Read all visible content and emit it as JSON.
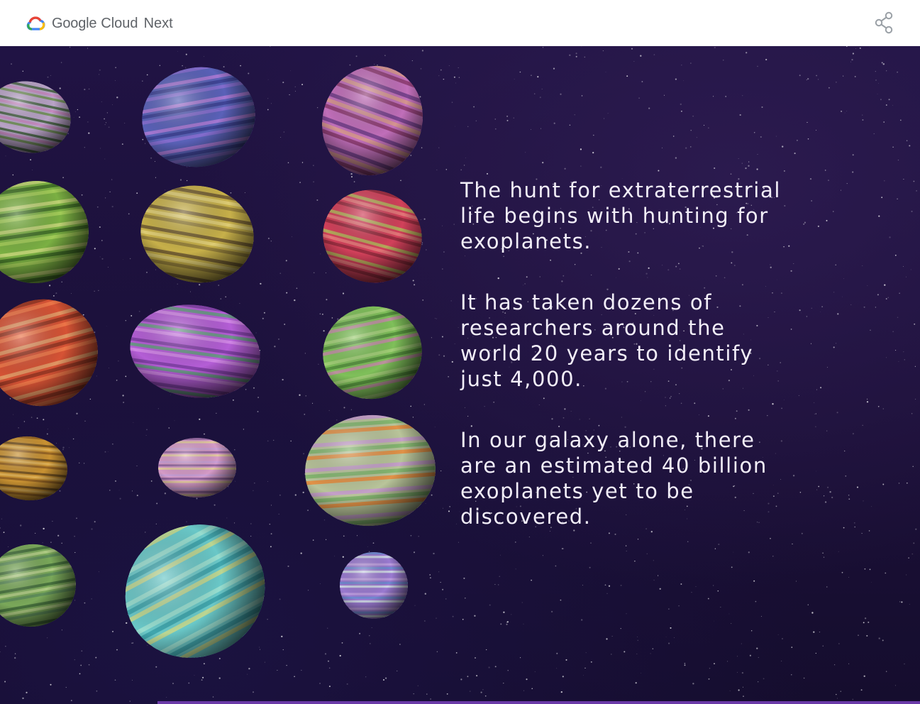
{
  "header": {
    "brand_google": "Google",
    "brand_cloud": "Cloud",
    "brand_next": "Next",
    "logo_icon": "google-cloud-logo-icon",
    "share_icon": "share-icon"
  },
  "story": {
    "paragraphs": [
      "The hunt for extraterrestrial life begins with hunting for exoplanets.",
      "It has taken dozens of researchers around the world 20 years to identify just 4,000.",
      "In our galaxy alone, there are an estimated 40 billion exoplanets yet to be discovered."
    ]
  },
  "colors": {
    "background": "#1c1038",
    "text": "#f2eef8",
    "progress": "#6b3aa8",
    "header_bg": "#ffffff",
    "header_text": "#5f6368"
  }
}
